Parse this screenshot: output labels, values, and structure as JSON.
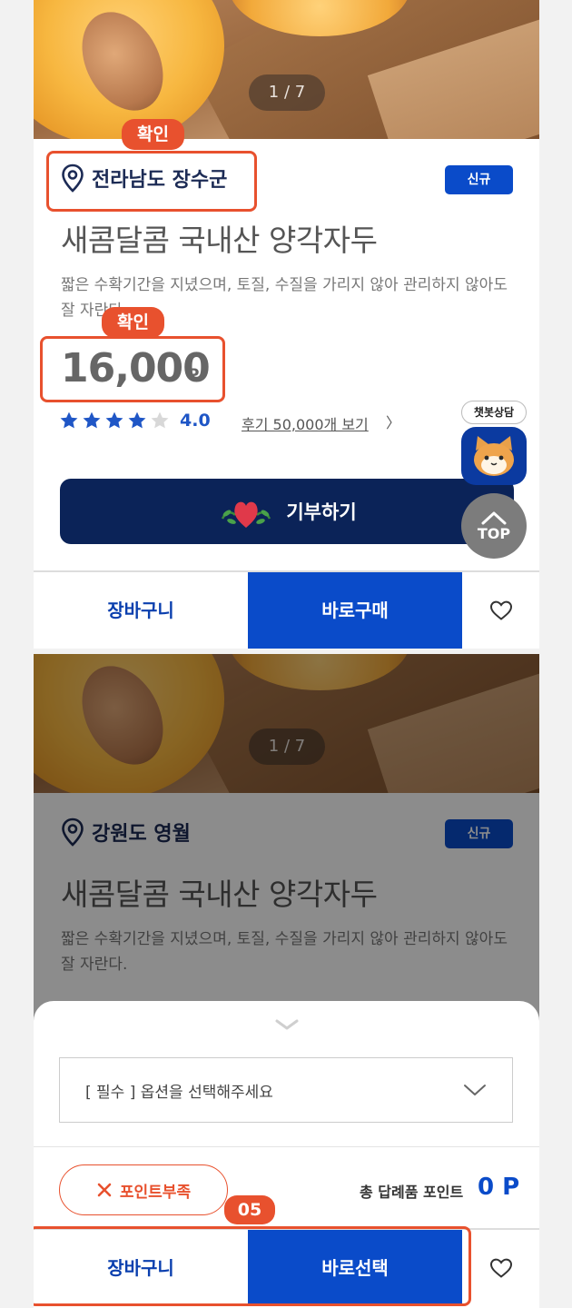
{
  "panel1": {
    "page_counter": "1 / 7",
    "callout_top": "확인",
    "location": "전라남도 장수군",
    "badge": "신규",
    "title": "새콤달콤 국내산 양각자두",
    "description": "짧은 수확기간을 지녔으며, 토질, 수질을 가리지 않아 관리하지 않아도 잘 자란다.",
    "callout_price": "확인",
    "price": "16,000",
    "price_unit": "P",
    "rating": {
      "value": 4.0,
      "display": "4.0",
      "max": 5,
      "filled": 4
    },
    "reviews": "후기 50,000개 보기",
    "reviews_chevron": "〉",
    "donate": "기부하기",
    "chatbot_label": "챗봇상담",
    "top_label": "TOP",
    "cart": "장바구니",
    "buy": "바로구매"
  },
  "panel2": {
    "page_counter": "1 / 7",
    "location": "강원도 영월",
    "badge": "신규",
    "title": "새콤달콤 국내산 양각자두",
    "description": "짧은 수확기간을 지녔으며, 토질, 수질을 가리지 않아 관리하지 않아도 잘 자란다.",
    "option_placeholder": "[ 필수 ] 옵션을 선택해주세요",
    "short_points": "포인트부족",
    "total_label": "총 답례품 포인트",
    "total_value": "0 P",
    "callout_tag": "05",
    "cart": "장바구니",
    "select": "바로선택"
  },
  "colors": {
    "accent": "#0a4bc9",
    "navy": "#0b2358",
    "callout": "#e8512e",
    "star": "#1f56c6"
  },
  "icons": [
    "location-pin-icon",
    "star-icon",
    "heart-icon",
    "chevron-up-icon",
    "chevron-down-icon",
    "close-icon",
    "cat-icon"
  ]
}
